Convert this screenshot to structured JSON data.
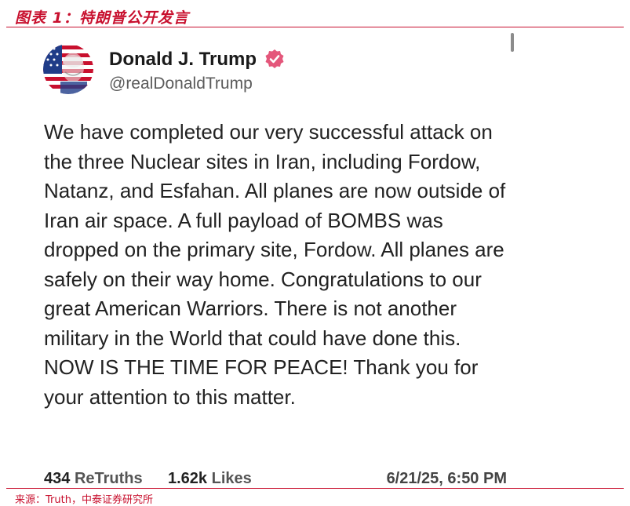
{
  "figure": {
    "title": "图表 1：特朗普公开发言",
    "source": "来源：Truth，中泰证券研究所"
  },
  "post": {
    "author_name": "Donald J. Trump",
    "handle": "@realDonaldTrump",
    "verified": true,
    "body": "We have completed our very successful attack on the three Nuclear sites in Iran, including Fordow, Natanz, and Esfahan. All planes are now outside of Iran air space. A full payload of BOMBS was dropped on the primary site, Fordow. All planes are safely on their way home. Congratulations to our great American Warriors. There is not another military in the World that could have done this. NOW IS THE TIME FOR PEACE! Thank you for your attention to this matter.",
    "retruths_count": "434",
    "retruths_label": "ReTruths",
    "likes_count": "1.62k",
    "likes_label": "Likes",
    "timestamp": "6/21/25, 6:50 PM"
  },
  "colors": {
    "accent": "#c8102e",
    "verified_badge": "#e4577b",
    "text": "#222222"
  },
  "icons": {
    "verified": "verified-badge-icon",
    "avatar": "flag-portrait-avatar"
  }
}
